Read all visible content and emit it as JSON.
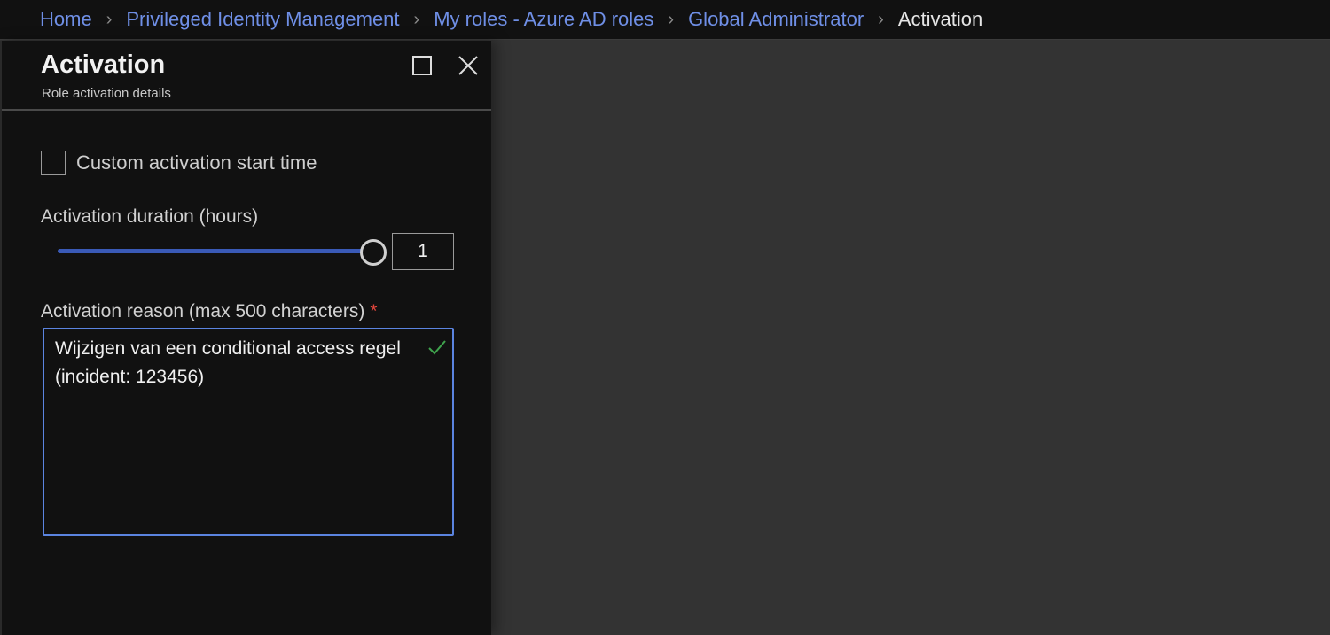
{
  "breadcrumb": [
    {
      "label": "Home",
      "link": true
    },
    {
      "label": "Privileged Identity Management",
      "link": true
    },
    {
      "label": "My roles - Azure AD roles",
      "link": true
    },
    {
      "label": "Global Administrator",
      "link": true
    },
    {
      "label": "Activation",
      "link": false
    }
  ],
  "blade": {
    "title": "Activation",
    "subtitle": "Role activation details",
    "maximize_icon": "maximize-icon",
    "close_icon": "close-icon"
  },
  "form": {
    "custom_start": {
      "label": "Custom activation start time",
      "checked": false
    },
    "duration": {
      "label": "Activation duration (hours)",
      "value": "1",
      "slider_fraction": 1.0
    },
    "reason": {
      "label": "Activation reason (max 500 characters)",
      "required_marker": "*",
      "value": "Wijzigen van een conditional access regel (incident: 123456)",
      "valid_icon": "checkmark-icon"
    }
  },
  "colors": {
    "link": "#6f8fe6",
    "accent": "#3a5ab7",
    "focus_border": "#5b84e0",
    "required": "#e0453c",
    "valid": "#3fa34d"
  }
}
